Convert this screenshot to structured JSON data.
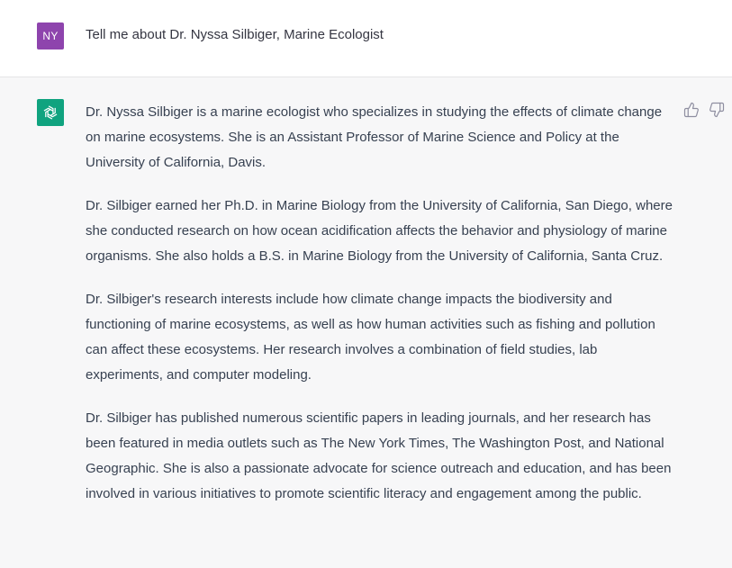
{
  "user_message": {
    "avatar_initials": "NY",
    "text": "Tell me about Dr. Nyssa Silbiger, Marine Ecologist"
  },
  "assistant_message": {
    "avatar_icon": "openai-logo-icon",
    "paragraphs": [
      "Dr. Nyssa Silbiger is a marine ecologist who specializes in studying the effects of climate change on marine ecosystems. She is an Assistant Professor of Marine Science and Policy at the University of California, Davis.",
      "Dr. Silbiger earned her Ph.D. in Marine Biology from the University of California, San Diego, where she conducted research on how ocean acidification affects the behavior and physiology of marine organisms. She also holds a B.S. in Marine Biology from the University of California, Santa Cruz.",
      "Dr. Silbiger's research interests include how climate change impacts the biodiversity and functioning of marine ecosystems, as well as how human activities such as fishing and pollution can affect these ecosystems. Her research involves a combination of field studies, lab experiments, and computer modeling.",
      "Dr. Silbiger has published numerous scientific papers in leading journals, and her research has been featured in media outlets such as The New York Times, The Washington Post, and National Geographic. She is also a passionate advocate for science outreach and education, and has been involved in various initiatives to promote scientific literacy and engagement among the public."
    ]
  },
  "feedback_icons": [
    "thumbs-up-icon",
    "thumbs-down-icon"
  ],
  "colors": {
    "user_avatar": "#8e44ad",
    "assistant_avatar": "#10a37f",
    "user_row_bg": "#ffffff",
    "assistant_row_bg": "#f7f7f8"
  }
}
